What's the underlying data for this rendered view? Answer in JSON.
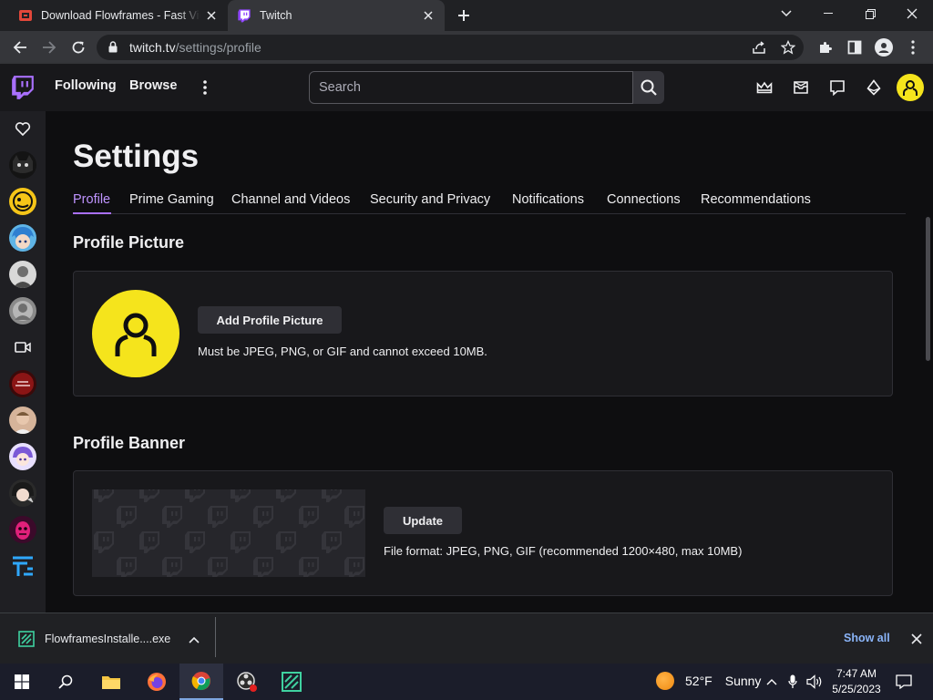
{
  "browser": {
    "tabs": [
      {
        "title": "Download Flowframes - Fast Vide",
        "active": false
      },
      {
        "title": "Twitch",
        "active": true
      }
    ],
    "url_host": "twitch.tv",
    "url_path": "/settings/profile"
  },
  "twitch_nav": {
    "following": "Following",
    "browse": "Browse",
    "search_placeholder": "Search"
  },
  "settings": {
    "title": "Settings",
    "tabs": [
      {
        "label": "Profile",
        "active": true
      },
      {
        "label": "Prime Gaming"
      },
      {
        "label": "Channel and Videos"
      },
      {
        "label": "Security and Privacy"
      },
      {
        "label": "Notifications"
      },
      {
        "label": "Connections"
      },
      {
        "label": "Recommendations"
      }
    ],
    "profile_picture": {
      "heading": "Profile Picture",
      "button": "Add Profile Picture",
      "hint": "Must be JPEG, PNG, or GIF and cannot exceed 10MB."
    },
    "profile_banner": {
      "heading": "Profile Banner",
      "button": "Update",
      "hint": "File format: JPEG, PNG, GIF (recommended 1200×480, max 10MB)"
    }
  },
  "download_shelf": {
    "file": "FlowframesInstalle....exe",
    "show_all": "Show all"
  },
  "taskbar": {
    "weather_temp": "52°F",
    "weather_text": "Sunny",
    "time": "7:47 AM",
    "date": "5/25/2023"
  },
  "colors": {
    "twitch_purple": "#9147ff",
    "active_tab": "#bf94ff",
    "avatar_yellow": "#f5e41c"
  }
}
